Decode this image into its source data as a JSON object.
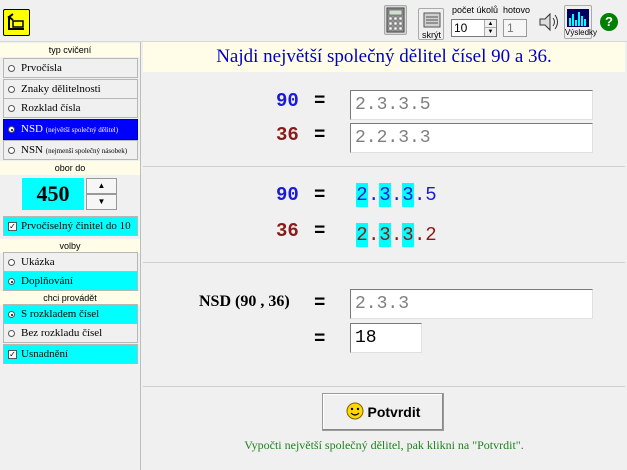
{
  "toolbar": {
    "hide_label": "skrýt",
    "task_count_label": "počet úkolů",
    "task_count_value": "10",
    "done_label": "hotovo",
    "done_value": "1",
    "results_label": "Výsledky",
    "icons": [
      "back-folder-icon",
      "calculator-icon",
      "hide-icon",
      "speaker-icon",
      "results-icon",
      "help-icon"
    ]
  },
  "left": {
    "section_exercise": "typ cvičení",
    "exercises": [
      {
        "label": "Prvočísla",
        "selected": false
      },
      {
        "label": "Znaky dělitelnosti",
        "selected": false
      },
      {
        "label": "Rozklad čísla",
        "selected": false
      },
      {
        "label": "NSD",
        "sub": "(největší společný dělitel)",
        "selected": true
      },
      {
        "label": "NSN",
        "sub": "(nejmenší společný násobek)",
        "selected": false
      }
    ],
    "section_range": "obor do",
    "range_value": "450",
    "prime_factor_label": "Prvočíselný činitel do 10",
    "prime_factor_checked": true,
    "section_options": "volby",
    "options": [
      {
        "label": "Ukázka",
        "selected": false
      },
      {
        "label": "Doplňování",
        "selected": true
      }
    ],
    "section_do": "chci provádět",
    "do_options": [
      {
        "label": "S rozkladem čísel",
        "selected": true
      },
      {
        "label": "Bez rozkladu čísel",
        "selected": false
      }
    ],
    "hint_label": "Usnadnění",
    "hint_checked": true
  },
  "main": {
    "title": "Najdi největší společný dělitel čísel  90 a 36.",
    "eq_sign": "=",
    "row1": {
      "number": "90",
      "factorization": "2.3.3.5"
    },
    "row2": {
      "number": "36",
      "factorization": "2.2.3.3"
    },
    "row3": {
      "number": "90",
      "digits": [
        "2",
        ".",
        "3",
        ".",
        "3",
        ".",
        "5"
      ],
      "hl": [
        true,
        false,
        true,
        false,
        true,
        false,
        false
      ]
    },
    "row4": {
      "number": "36",
      "digits": [
        "2",
        ".",
        "3",
        ".",
        "3",
        ".",
        "2"
      ],
      "hl": [
        true,
        false,
        true,
        false,
        true,
        false,
        false
      ]
    },
    "nsd_label": "NSD (90 , 36)",
    "nsd_factorization": "2.3.3",
    "nsd_result": "18",
    "confirm_label": "Potvrdit",
    "hint_text": "Vypočti největší společný dělitel, pak klikni na \"Potvrdit\"."
  }
}
